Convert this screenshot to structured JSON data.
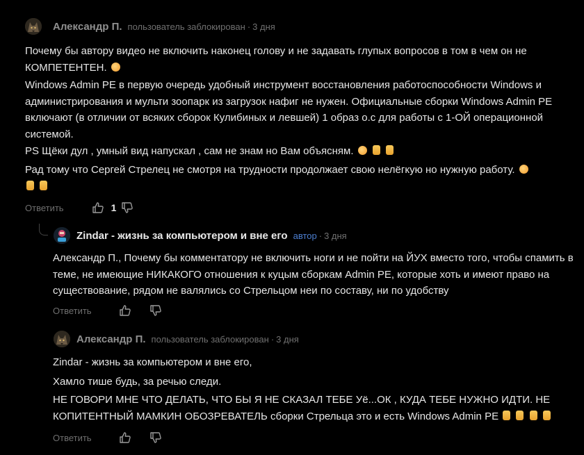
{
  "comments": [
    {
      "author": "Александр П.",
      "status": "пользователь заблокирован",
      "dot": "·",
      "time": "3 дня",
      "paragraphs": [
        "Почему бы автору видео не включить наконец голову и не задавать глупых вопросов в том в чем он не КОМПЕТЕНТЕН.",
        "Windows Admin PE в первую очередь удобный инструмент восстановления работоспособности Windows и администрирования и мульти зоопарк из загрузок нафиг не нужен. Официальные сборки Windows Admin PE включают (в отличии от всяких сборок Кулибиных и левшей) 1 образ о.с для работы с 1-ОЙ операционной системой.",
        "PS Щёки дул , умный вид напускал , сам не знам но Вам объясням.",
        "Рад тому что Сергей Стрелец не смотря на трудности продолжает свою нелёгкую но нужную работу."
      ],
      "reply_label": "Ответить",
      "likes": "1"
    },
    {
      "author": "Zindar - жизнь за компьютером и вне его",
      "badge": "автор",
      "dot": "·",
      "time": "3 дня",
      "text": "Александр П., Почему бы комментатору не включить ноги и не пойти на ЙУХ вместо того, чтобы спамить в теме, не имеющие НИКАКОГО отношения к куцым сборкам Admin PE, которые хоть и имеют право на существование, рядом не валялись со Стрельцом неи по составу, ни по удобству",
      "reply_label": "Ответить"
    },
    {
      "author": "Александр П.",
      "status": "пользователь заблокирован",
      "dot": "·",
      "time": "3 дня",
      "paragraphs": [
        "Zindar - жизнь за компьютером и вне его,",
        "Хамло тише будь, за речью следи.",
        "НЕ ГОВОРИ МНЕ ЧТО ДЕЛАТЬ, ЧТО БЫ Я НЕ СКАЗАЛ ТЕБЕ Уё...ОК , КУДА ТЕБЕ НУЖНО ИДТИ. НЕ КОПИТЕНТНЫЙ МАМКИН ОБОЗРЕВАТЕЛЬ сборки Стрельца это и есть Windows Admin PE"
      ],
      "reply_label": "Ответить"
    }
  ],
  "icons": {
    "avatar_1": "wolf-avatar-icon",
    "avatar_2": "zindar-avatar-icon",
    "like": "thumb-up-icon",
    "dislike": "thumb-down-icon",
    "emoji_face": "flushed-face-icon",
    "emoji_down": "thumbs-down-emoji-icon",
    "emoji_up": "thumbs-up-emoji-icon",
    "emoji_point": "pointing-up-emoji-icon"
  },
  "colors": {
    "background": "#000000",
    "text": "#e6e6e6",
    "muted": "#707070",
    "author_badge": "#4c7ecf"
  }
}
